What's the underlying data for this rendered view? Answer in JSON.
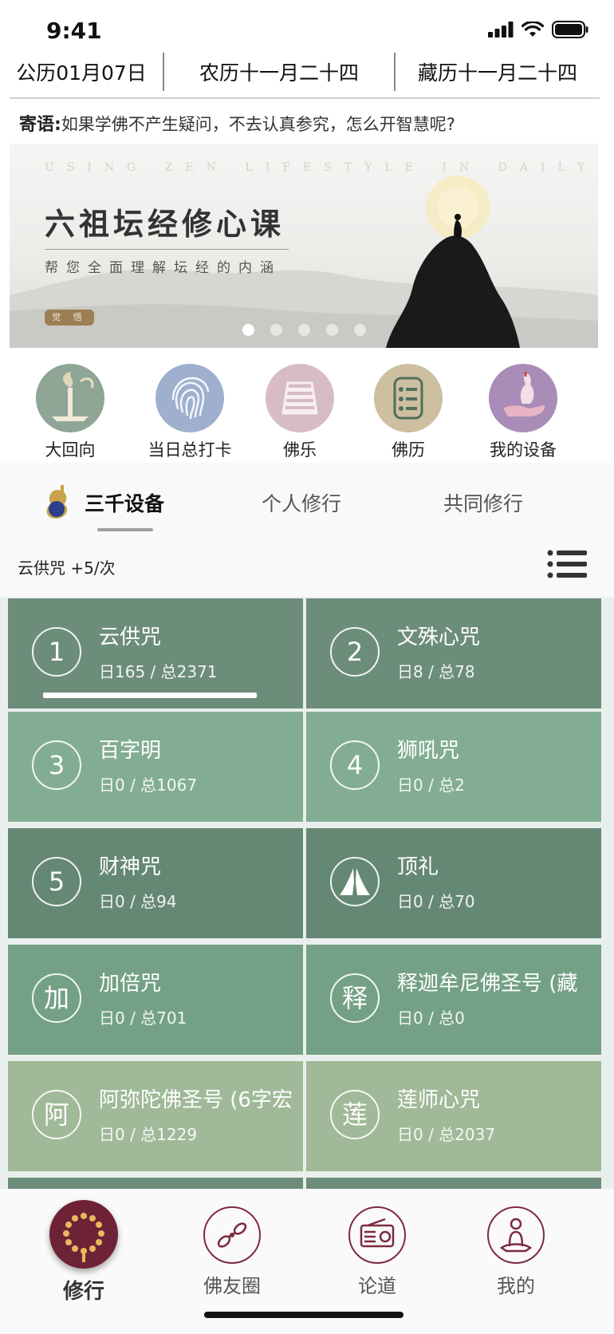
{
  "status_bar": {
    "time": "9:41"
  },
  "dates": {
    "gregorian": "公历01月07日",
    "lunar": "农历十一月二十四",
    "tibetan": "藏历十一月二十四"
  },
  "message": {
    "label": "寄语:",
    "text": "如果学佛不产生疑问，不去认真参究，怎么开智慧呢?"
  },
  "banner": {
    "tagline": "USING ZEN LIFESTYLE IN DAILY LIFE",
    "title": "六祖坛经修心课",
    "subtitle": "帮您全面理解坛经的内涵",
    "badge": "觉 悟",
    "page_count": 5,
    "active_page": 1
  },
  "quick_actions": [
    {
      "label": "大回向",
      "icon": "incense-offering-icon"
    },
    {
      "label": "当日总打卡",
      "icon": "fingerprint-icon"
    },
    {
      "label": "佛乐",
      "icon": "xylophone-icon"
    },
    {
      "label": "佛历",
      "icon": "calendar-list-icon"
    },
    {
      "label": "我的设备",
      "icon": "hand-bottle-icon"
    }
  ],
  "tabs": [
    {
      "label": "三千设备",
      "active": true
    },
    {
      "label": "个人修行",
      "active": false
    },
    {
      "label": "共同修行",
      "active": false
    }
  ],
  "sub_header": {
    "text": "云供咒   +5/次"
  },
  "practices": [
    {
      "badge": "1",
      "name": "云供咒",
      "count": "日165 / 总2371",
      "progress": 0.75,
      "color": "#6d8d7b"
    },
    {
      "badge": "2",
      "name": "文殊心咒",
      "count": "日8 / 总78",
      "color": "#6d8d7b"
    },
    {
      "badge": "3",
      "name": "百字明",
      "count": "日0 / 总1067",
      "color": "#83ad93"
    },
    {
      "badge": "4",
      "name": "狮吼咒",
      "count": "日0 / 总2",
      "color": "#83ad93"
    },
    {
      "badge": "5",
      "name": "财神咒",
      "count": "日0 / 总94",
      "color": "#658875"
    },
    {
      "badge": "",
      "icon": "praying-hands-icon",
      "name": "顶礼",
      "count": "日0 / 总70",
      "color": "#658875"
    },
    {
      "badge": "加",
      "name": "加倍咒",
      "count": "日0 / 总701",
      "color": "#74a186"
    },
    {
      "badge": "释",
      "name": "释迦牟尼佛圣号 (藏",
      "count": "日0 / 总0",
      "color": "#74a186"
    },
    {
      "badge": "阿",
      "name": "阿弥陀佛圣号 (6字宏",
      "count": "日0 / 总1229",
      "color": "#a0b998"
    },
    {
      "badge": "莲",
      "name": "莲师心咒",
      "count": "日0 / 总2037",
      "color": "#a0b998"
    }
  ],
  "bottom_nav": [
    {
      "label": "修行",
      "icon": "prayer-beads-icon",
      "active": true
    },
    {
      "label": "佛友圈",
      "icon": "vajra-icon",
      "active": false
    },
    {
      "label": "论道",
      "icon": "radio-icon",
      "active": false
    },
    {
      "label": "我的",
      "icon": "meditating-person-icon",
      "active": false
    }
  ],
  "colors": {
    "accent": "#6e2236",
    "card_dark": "#658875",
    "card_mid": "#83ad93",
    "card_light": "#a0b998"
  }
}
